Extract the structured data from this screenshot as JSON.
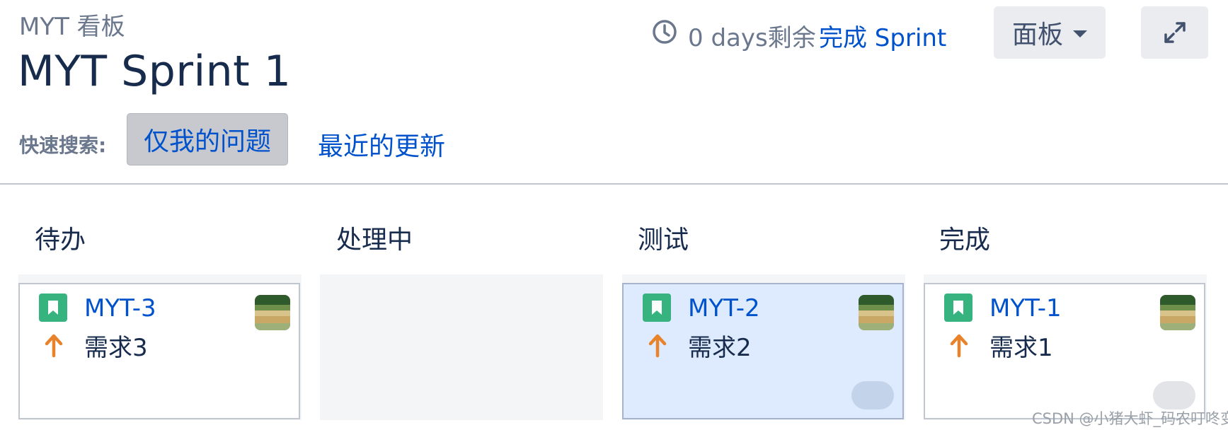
{
  "header": {
    "board_name": "MYT 看板",
    "sprint_title": "MYT Sprint 1",
    "days_remaining": "0 days剩余",
    "complete_sprint_label": "完成 Sprint",
    "board_menu_label": "面板"
  },
  "quick_search": {
    "label": "快速搜索:",
    "filters": [
      "仅我的问题",
      "最近的更新"
    ]
  },
  "columns": [
    {
      "name": "待办",
      "cards": [
        {
          "key": "MYT-3",
          "summary": "需求3",
          "type_icon": "story-icon",
          "priority_icon": "priority-high-arrow-icon",
          "selected": false,
          "estimate_badge": false
        }
      ]
    },
    {
      "name": "处理中",
      "cards": []
    },
    {
      "name": "测试",
      "cards": [
        {
          "key": "MYT-2",
          "summary": "需求2",
          "type_icon": "story-icon",
          "priority_icon": "priority-high-arrow-icon",
          "selected": true,
          "estimate_badge": true
        }
      ]
    },
    {
      "name": "完成",
      "cards": [
        {
          "key": "MYT-1",
          "summary": "需求1",
          "type_icon": "story-icon",
          "priority_icon": "priority-high-arrow-icon",
          "selected": false,
          "estimate_badge": true
        }
      ]
    }
  ],
  "watermark": "CSDN @小猪大虾_码农叮咚变",
  "colors": {
    "link": "#0052cc",
    "story": "#36b37e",
    "priority_high": "#e8822b",
    "selected_card": "#deebff",
    "button_bg": "#ebecf0"
  }
}
